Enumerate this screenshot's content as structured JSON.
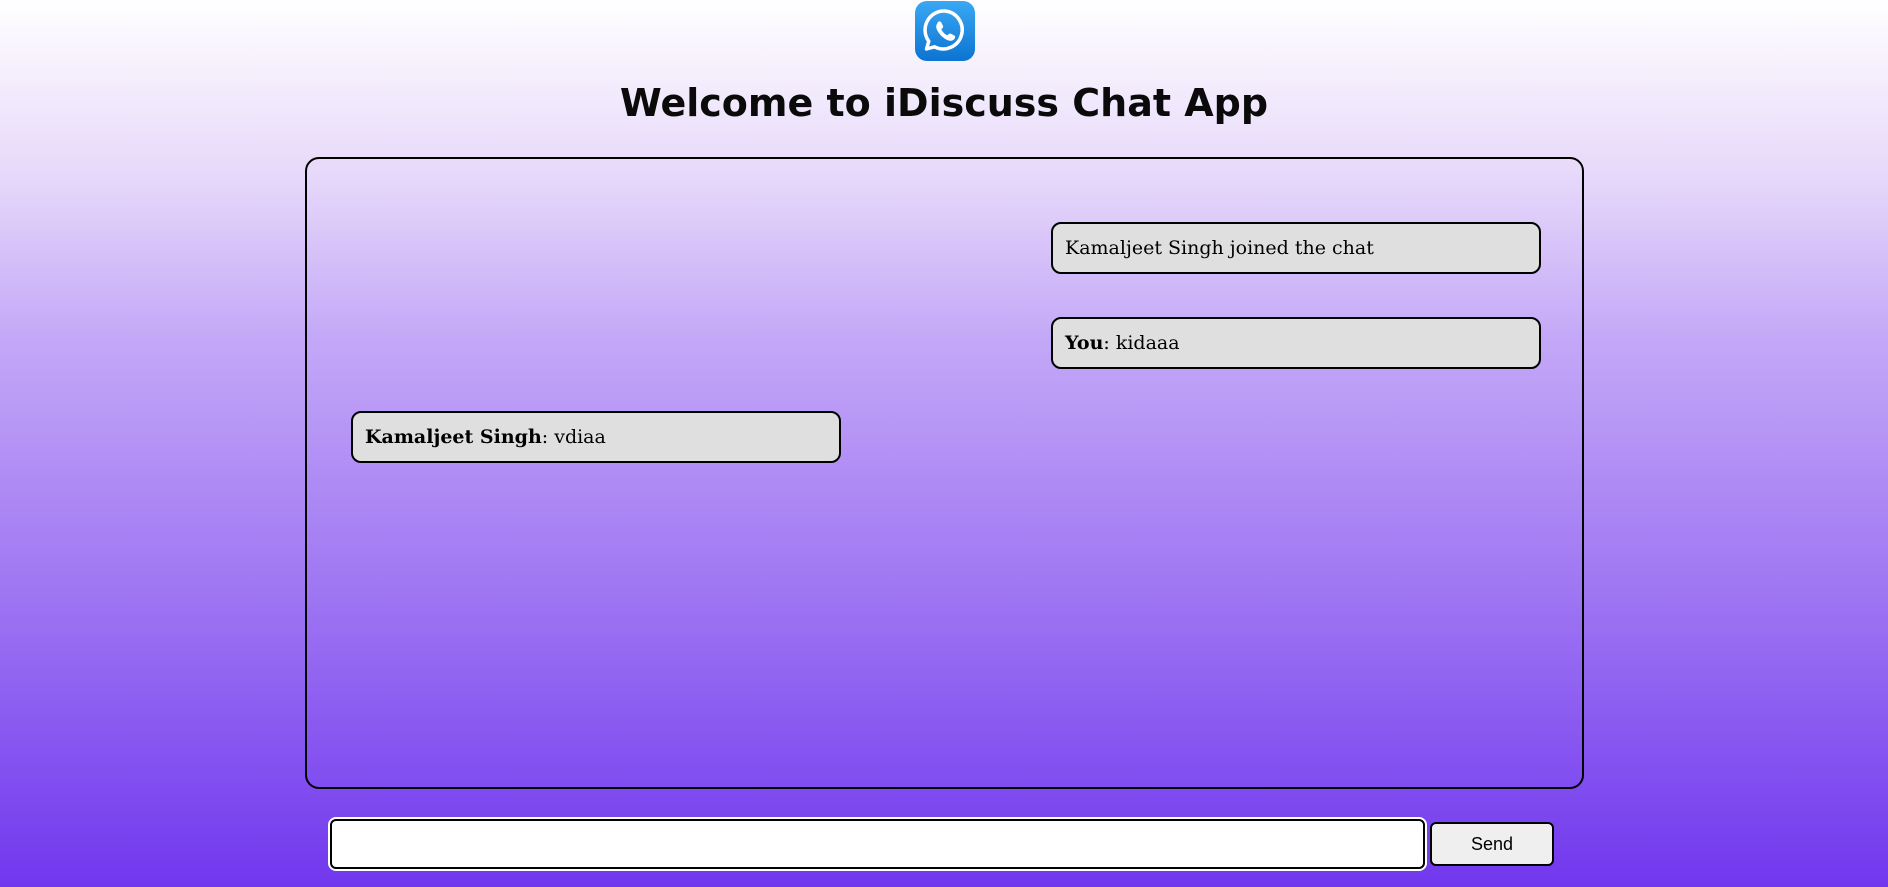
{
  "header": {
    "logo_icon": "whatsapp-logo-icon",
    "title": "Welcome to iDiscuss Chat App"
  },
  "chat": {
    "messages": [
      {
        "position": "right",
        "sender": "",
        "text": "Kamaljeet Singh joined the chat"
      },
      {
        "position": "right",
        "sender": "You",
        "text": ": kidaaa"
      },
      {
        "position": "left",
        "sender": "Kamaljeet Singh",
        "text": ": vdiaa"
      }
    ]
  },
  "composer": {
    "input_value": "",
    "placeholder": "",
    "send_label": "Send"
  },
  "colors": {
    "gradient_top": "#ffffff",
    "gradient_bottom": "#7137ee",
    "message_bg": "#e0dfdf",
    "logo_blue": "#1a8ee8"
  }
}
